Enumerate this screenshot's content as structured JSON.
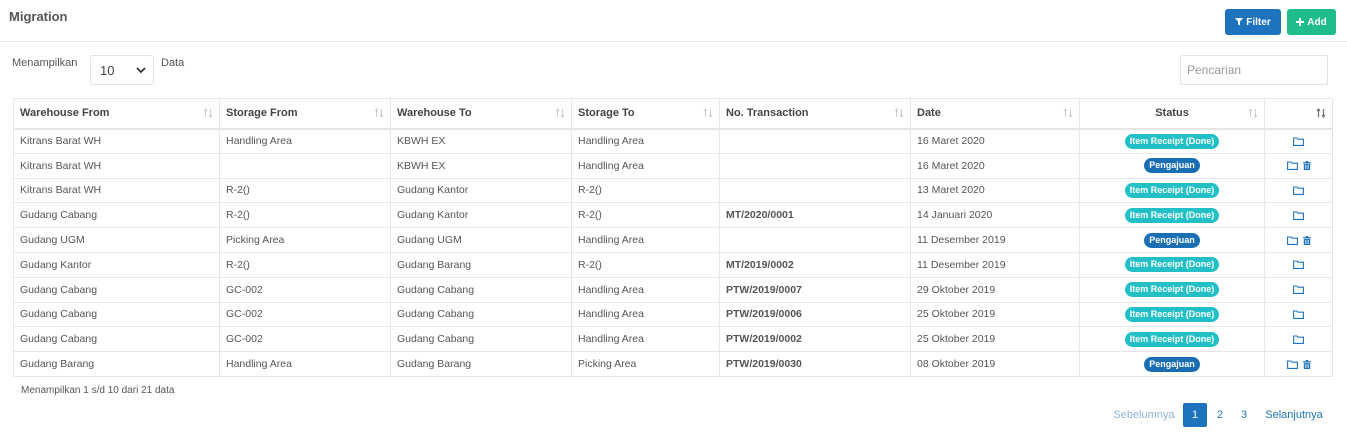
{
  "header": {
    "title": "Migration",
    "filter_label": "Filter",
    "add_label": "Add"
  },
  "length_control": {
    "prefix": "Menampilkan",
    "value": "10",
    "suffix": "Data"
  },
  "search": {
    "placeholder": "Pencarian",
    "value": ""
  },
  "table": {
    "columns": [
      "Warehouse From",
      "Storage From",
      "Warehouse To",
      "Storage To",
      "No. Transaction",
      "Date",
      "Status"
    ],
    "rows": [
      {
        "warehouse_from": "Kitrans Barat WH",
        "storage_from": "Handling Area",
        "warehouse_to": "KBWH EX",
        "storage_to": "Handling Area",
        "no_transaction": "",
        "date": "16 Maret 2020",
        "status": "Item Receipt (Done)",
        "status_type": "done",
        "deletable": false
      },
      {
        "warehouse_from": "Kitrans Barat WH",
        "storage_from": "",
        "warehouse_to": "KBWH EX",
        "storage_to": "Handling Area",
        "no_transaction": "",
        "date": "16 Maret 2020",
        "status": "Pengajuan",
        "status_type": "pengajuan",
        "deletable": true
      },
      {
        "warehouse_from": "Kitrans Barat WH",
        "storage_from": "R-2()",
        "warehouse_to": "Gudang Kantor",
        "storage_to": "R-2()",
        "no_transaction": "",
        "date": "13 Maret 2020",
        "status": "Item Receipt (Done)",
        "status_type": "done",
        "deletable": false
      },
      {
        "warehouse_from": "Gudang Cabang",
        "storage_from": "R-2()",
        "warehouse_to": "Gudang Kantor",
        "storage_to": "R-2()",
        "no_transaction": "MT/2020/0001",
        "date": "14 Januari 2020",
        "status": "Item Receipt (Done)",
        "status_type": "done",
        "deletable": false
      },
      {
        "warehouse_from": "Gudang UGM",
        "storage_from": "Picking Area",
        "warehouse_to": "Gudang UGM",
        "storage_to": "Handling Area",
        "no_transaction": "",
        "date": "11 Desember 2019",
        "status": "Pengajuan",
        "status_type": "pengajuan",
        "deletable": true
      },
      {
        "warehouse_from": "Gudang Kantor",
        "storage_from": "R-2()",
        "warehouse_to": "Gudang Barang",
        "storage_to": "R-2()",
        "no_transaction": "MT/2019/0002",
        "date": "11 Desember 2019",
        "status": "Item Receipt (Done)",
        "status_type": "done",
        "deletable": false
      },
      {
        "warehouse_from": "Gudang Cabang",
        "storage_from": "GC-002",
        "warehouse_to": "Gudang Cabang",
        "storage_to": "Handling Area",
        "no_transaction": "PTW/2019/0007",
        "date": "29 Oktober 2019",
        "status": "Item Receipt (Done)",
        "status_type": "done",
        "deletable": false
      },
      {
        "warehouse_from": "Gudang Cabang",
        "storage_from": "GC-002",
        "warehouse_to": "Gudang Cabang",
        "storage_to": "Handling Area",
        "no_transaction": "PTW/2019/0006",
        "date": "25 Oktober 2019",
        "status": "Item Receipt (Done)",
        "status_type": "done",
        "deletable": false
      },
      {
        "warehouse_from": "Gudang Cabang",
        "storage_from": "GC-002",
        "warehouse_to": "Gudang Cabang",
        "storage_to": "Handling Area",
        "no_transaction": "PTW/2019/0002",
        "date": "25 Oktober 2019",
        "status": "Item Receipt (Done)",
        "status_type": "done",
        "deletable": false
      },
      {
        "warehouse_from": "Gudang Barang",
        "storage_from": "Handling Area",
        "warehouse_to": "Gudang Barang",
        "storage_to": "Picking Area",
        "no_transaction": "PTW/2019/0030",
        "date": "08 Oktober 2019",
        "status": "Pengajuan",
        "status_type": "pengajuan",
        "deletable": true
      }
    ]
  },
  "footer": {
    "info": "Menampilkan 1 s/d 10 dari 21 data",
    "prev_label": "Sebelumnya",
    "pages": [
      "1",
      "2",
      "3"
    ],
    "current_page": "1",
    "next_label": "Selanjutnya"
  },
  "colors": {
    "primary": "#1e73be",
    "success": "#1fbc8c",
    "badge_done": "#22c0c6",
    "badge_pengajuan": "#1a6fb4"
  },
  "icons": {
    "filter": "filter-icon",
    "add": "plus-icon",
    "length_dropdown": "chevron-down-icon",
    "sort": "sort-icon",
    "row_detail": "folder-icon",
    "row_delete": "trash-icon"
  }
}
